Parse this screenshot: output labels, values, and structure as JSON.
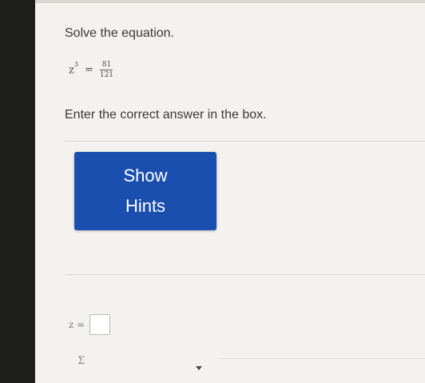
{
  "question": {
    "prompt": "Solve the equation.",
    "equation": {
      "lhs_base": "z",
      "lhs_exponent": "3",
      "equals": "=",
      "numerator": "81",
      "denominator": "121"
    },
    "instruction": "Enter the correct answer in the box."
  },
  "hints": {
    "button_line1": "Show",
    "button_line2": "Hints"
  },
  "answer": {
    "label": "z =",
    "value": ""
  },
  "toolbar": {
    "symbol": "Σ"
  }
}
